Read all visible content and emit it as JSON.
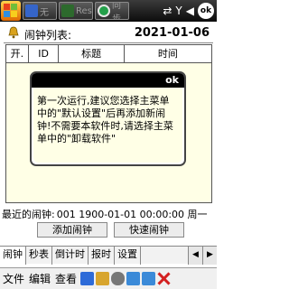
{
  "statusbar": {
    "tasks": [
      {
        "label": "无"
      },
      {
        "label": "Res"
      },
      {
        "label": "同步"
      }
    ],
    "ok": "ok"
  },
  "list": {
    "label": "闹钟列表:",
    "date": "2021-01-06",
    "columns": [
      "开.",
      "ID",
      "标题",
      "时间"
    ]
  },
  "message": {
    "ok": "ok",
    "text": "第一次运行,建议您选择主菜单中的\"默认设置\"后再添加新闹钟!不需要本软件时,请选择主菜单中的\"卸载软件\""
  },
  "recent": {
    "label": "最近的闹钟:",
    "value": "001 1900-01-01 00:00:00 周一"
  },
  "buttons": {
    "add": "添加闹钟",
    "quick": "快速闹钟"
  },
  "tabs": [
    "闹钟",
    "秒表",
    "倒计时",
    "报时",
    "设置"
  ],
  "menu": {
    "file": "文件",
    "edit": "编辑",
    "view": "查看"
  },
  "colors": {
    "list_background": "#ffffe6",
    "titlebar": "#000000"
  }
}
